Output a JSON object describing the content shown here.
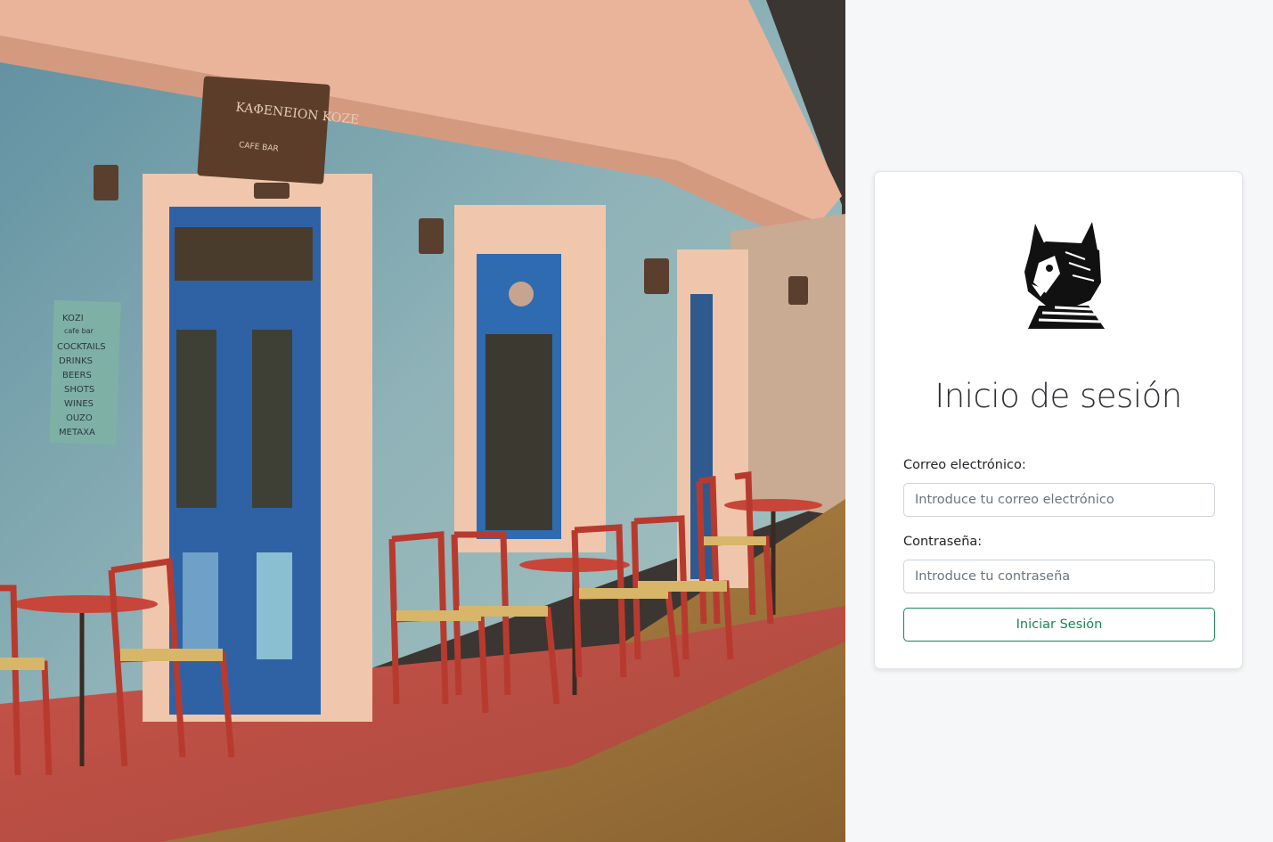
{
  "login": {
    "title": "Inicio de sesión",
    "email_label": "Correo electrónico:",
    "email_placeholder": "Introduce tu correo electrónico",
    "email_value": "",
    "password_label": "Contraseña:",
    "password_placeholder": "Introduce tu contraseña",
    "password_value": "",
    "submit_label": "Iniciar Sesión"
  },
  "photo": {
    "sign_text": "KAΦENEION KOZE",
    "sign_subtext": "CAFE BAR",
    "menu_lines": [
      "KOZI",
      "cafe bar",
      "COCKTAILS",
      "DRINKS",
      "BEERS",
      "SHOTS",
      "WINES",
      "OUZO",
      "METAXA"
    ]
  },
  "logo": {
    "icon": "lynx-logo-icon"
  },
  "colors": {
    "accent": "#198754",
    "background": "#f6f7f9",
    "card": "#ffffff"
  }
}
